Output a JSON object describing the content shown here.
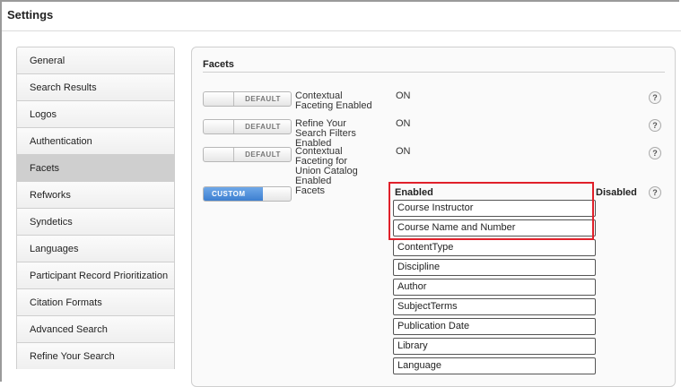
{
  "window": {
    "title": "Settings"
  },
  "sidebar": {
    "items": [
      {
        "label": "General"
      },
      {
        "label": "Search Results"
      },
      {
        "label": "Logos"
      },
      {
        "label": "Authentication"
      },
      {
        "label": "Facets"
      },
      {
        "label": "Refworks"
      },
      {
        "label": "Syndetics"
      },
      {
        "label": "Languages"
      },
      {
        "label": "Participant Record Prioritization"
      },
      {
        "label": "Citation Formats"
      },
      {
        "label": "Advanced Search"
      },
      {
        "label": "Refine Your Search"
      }
    ],
    "active_index": 4
  },
  "panel": {
    "title": "Facets",
    "settings": [
      {
        "toggle": "DEFAULT",
        "label": "Contextual Faceting Enabled",
        "value": "ON",
        "help": "?"
      },
      {
        "toggle": "DEFAULT",
        "label": "Refine Your Search Filters Enabled",
        "value": "ON",
        "help": "?"
      },
      {
        "toggle": "DEFAULT",
        "label": "Contextual Faceting for Union Catalog Enabled",
        "value": "ON",
        "help": "?"
      }
    ],
    "facets": {
      "toggle": "CUSTOM",
      "label": "Facets",
      "enabled_header": "Enabled",
      "disabled_header": "Disabled",
      "help": "?",
      "enabled_items": [
        "Course Instructor",
        "Course Name and Number",
        "ContentType",
        "Discipline",
        "Author",
        "SubjectTerms",
        "Publication Date",
        "Library",
        "Language"
      ]
    }
  },
  "colors": {
    "highlight": "#e0202a",
    "custom_toggle": "#3d7fd0"
  }
}
